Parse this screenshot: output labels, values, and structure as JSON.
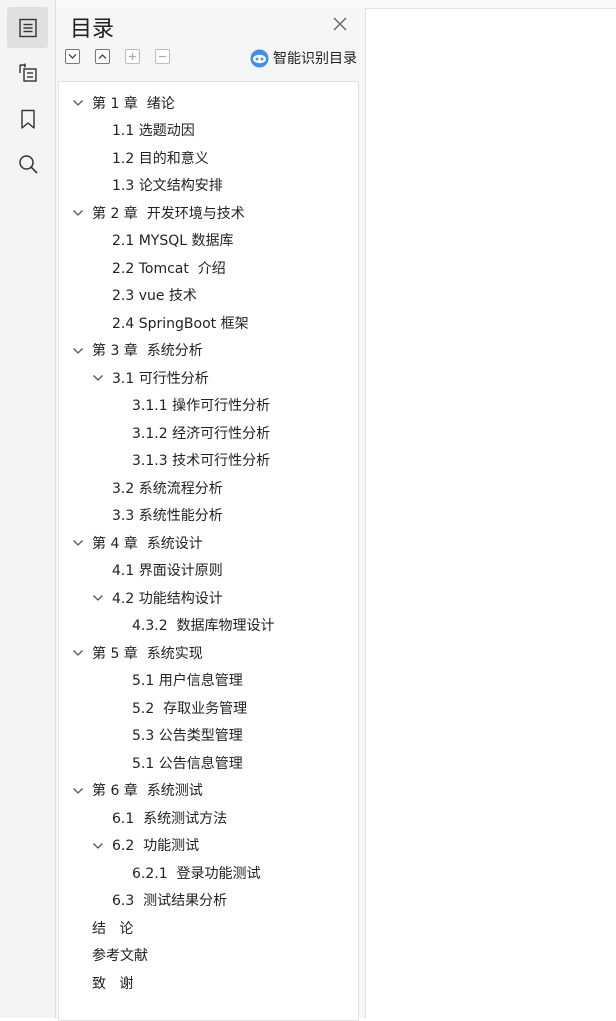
{
  "panel": {
    "title": "目录",
    "smart_toc_label": "智能识别目录"
  },
  "toc": [
    {
      "label": "第 1 章  绪论",
      "expanded": true
    },
    {
      "label": "1.1 选题动因"
    },
    {
      "label": "1.2 目的和意义"
    },
    {
      "label": "1.3 论文结构安排"
    },
    {
      "label": "第 2 章  开发环境与技术",
      "expanded": true
    },
    {
      "label": "2.1 MYSQL 数据库"
    },
    {
      "label": "2.2 Tomcat  介绍"
    },
    {
      "label": "2.3 vue 技术"
    },
    {
      "label": "2.4 SpringBoot 框架"
    },
    {
      "label": "第 3 章  系统分析",
      "expanded": true
    },
    {
      "label": "3.1 可行性分析",
      "expanded": true
    },
    {
      "label": "3.1.1 操作可行性分析"
    },
    {
      "label": "3.1.2 经济可行性分析"
    },
    {
      "label": "3.1.3 技术可行性分析"
    },
    {
      "label": "3.2 系统流程分析"
    },
    {
      "label": "3.3 系统性能分析"
    },
    {
      "label": "第 4 章  系统设计",
      "expanded": true
    },
    {
      "label": "4.1 界面设计原则"
    },
    {
      "label": "4.2 功能结构设计",
      "expanded": true
    },
    {
      "label": "4.3.2  数据库物理设计"
    },
    {
      "label": "第 5 章  系统实现",
      "expanded": true
    },
    {
      "label": "5.1 用户信息管理"
    },
    {
      "label": "5.2  存取业务管理"
    },
    {
      "label": "5.3 公告类型管理"
    },
    {
      "label": "5.1 公告信息管理"
    },
    {
      "label": "第 6 章  系统测试",
      "expanded": true
    },
    {
      "label": "6.1  系统测试方法"
    },
    {
      "label": "6.2  功能测试",
      "expanded": true
    },
    {
      "label": "6.2.1  登录功能测试"
    },
    {
      "label": "6.3  测试结果分析"
    },
    {
      "label": "结   论"
    },
    {
      "label": "参考文献"
    },
    {
      "label": "致   谢"
    }
  ]
}
